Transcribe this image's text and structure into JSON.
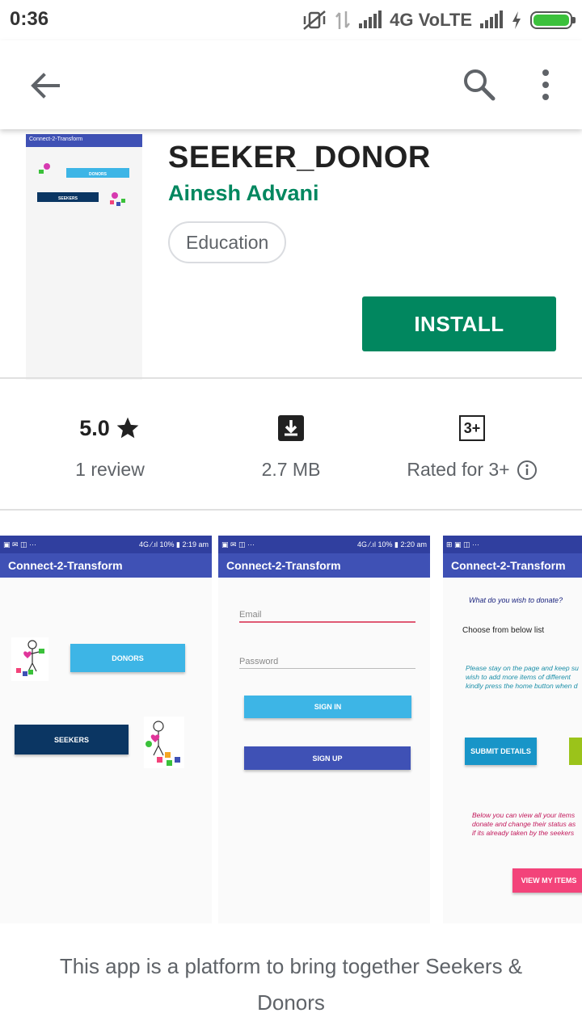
{
  "status": {
    "time": "0:36",
    "network": "4G VoLTE"
  },
  "toolbar": {
    "back_icon": "arrow-left-icon",
    "search_icon": "search-icon",
    "more_icon": "more-vert-icon"
  },
  "app": {
    "title": "SEEKER_DONOR",
    "developer": "Ainesh Advani",
    "category": "Education",
    "install_label": "INSTALL",
    "icon_caption": "Connect-2-Transform",
    "icon_donors": "DONORS",
    "icon_seekers": "SEEKERS"
  },
  "stats": {
    "rating_value": "5.0",
    "rating_sub": "1 review",
    "size_value": "2.7 MB",
    "content_badge": "3+",
    "content_sub": "Rated for 3+"
  },
  "screenshots": [
    {
      "status_left": "▣ ✉ ◫ ···",
      "status_right": "4G ⁄.ıl 10% ▮ 2:19 am",
      "appbar": "Connect-2-Transform",
      "donors_btn": "DONORS",
      "seekers_btn": "SEEKERS"
    },
    {
      "status_left": "▣ ✉ ◫ ···",
      "status_right": "4G ⁄.ıl 10% ▮ 2:20 am",
      "appbar": "Connect-2-Transform",
      "email_placeholder": "Email",
      "password_placeholder": "Password",
      "sign_in": "SIGN IN",
      "sign_up": "SIGN UP"
    },
    {
      "status_left": "⊞ ▣ ◫ ···",
      "status_right": "",
      "appbar": "Connect-2-Transform",
      "question": "What do you wish to donate?",
      "choose": "Choose from below list",
      "note1_l1": "Please stay on the page and keep su",
      "note1_l2": "wish to add more items of different",
      "note1_l3": "kindly press the home button when d",
      "submit_btn": "SUBMIT DETAILS",
      "note2_l1": "Below you can view all your items",
      "note2_l2": "donate and change their status as",
      "note2_l3": "if its already taken by the seekers",
      "view_btn": "VIEW MY ITEMS"
    }
  ],
  "description": "This app is a platform to bring together Seekers & Donors",
  "colors": {
    "install_green": "#01875f",
    "app_primary": "#3f51b5",
    "donor_blue": "#3db5e6",
    "seeker_navy": "#0b3663",
    "view_pink": "#f3437a"
  }
}
